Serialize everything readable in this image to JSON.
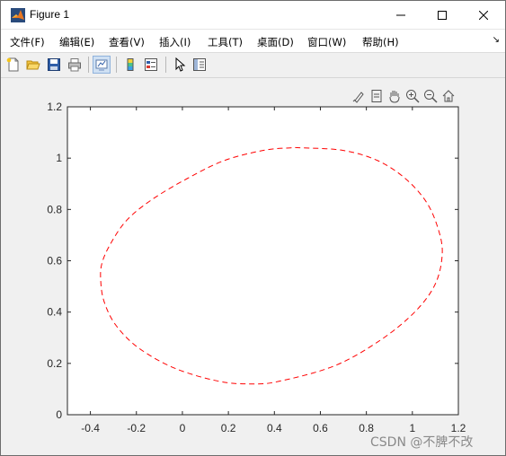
{
  "window": {
    "title": "Figure 1",
    "controls": {
      "minimize": "minimize-icon",
      "maximize": "maximize-icon",
      "close": "close-icon"
    }
  },
  "menu": {
    "items": [
      {
        "label": "文件(F)"
      },
      {
        "label": "编辑(E)"
      },
      {
        "label": "查看(V)"
      },
      {
        "label": "插入(I)"
      },
      {
        "label": "工具(T)"
      },
      {
        "label": "桌面(D)"
      },
      {
        "label": "窗口(W)"
      },
      {
        "label": "帮助(H)"
      }
    ],
    "overflow_icon": "menu-overflow-arrow-icon"
  },
  "toolbar": {
    "buttons": [
      "new-figure-icon",
      "open-file-icon",
      "save-icon",
      "print-icon",
      "link-plot-icon",
      "insert-colorbar-icon",
      "insert-legend-icon",
      "edit-plot-icon",
      "property-inspector-icon"
    ]
  },
  "axes_toolbar": {
    "buttons": [
      "brush-icon",
      "data-tips-icon",
      "pan-icon",
      "zoom-in-icon",
      "zoom-out-icon",
      "home-icon"
    ]
  },
  "chart_data": {
    "type": "line",
    "title": "",
    "xlabel": "",
    "ylabel": "",
    "xlim": [
      -0.5,
      1.2
    ],
    "ylim": [
      0,
      1.2
    ],
    "xticks": [
      -0.4,
      -0.2,
      0,
      0.2,
      0.4,
      0.6,
      0.8,
      1,
      1.2
    ],
    "yticks": [
      0,
      0.2,
      0.4,
      0.6,
      0.8,
      1,
      1.2
    ],
    "xtick_labels": [
      "-0.4",
      "-0.2",
      "0",
      "0.2",
      "0.4",
      "0.6",
      "0.8",
      "1",
      "1.2"
    ],
    "ytick_labels": [
      "0",
      "0.2",
      "0.4",
      "0.6",
      "0.8",
      "1",
      "1.2"
    ],
    "grid": false,
    "series": [
      {
        "color": "#ff0000",
        "line_style": "dashed",
        "shape": "ellipse",
        "x": [
          1.13,
          1.11,
          1.06,
          0.97,
          0.85,
          0.7,
          0.52,
          0.47,
          0.35,
          0.18,
          0.02,
          -0.13,
          -0.24,
          -0.31,
          -0.35,
          -0.355,
          -0.34,
          -0.29,
          -0.19,
          -0.03,
          0.16,
          0.3,
          0.42,
          0.66,
          0.86,
          1.01,
          1.1,
          1.13
        ],
        "y": [
          0.63,
          0.73,
          0.83,
          0.92,
          0.99,
          1.03,
          1.04,
          1.04,
          1.03,
          0.99,
          0.92,
          0.84,
          0.76,
          0.67,
          0.59,
          0.52,
          0.44,
          0.35,
          0.26,
          0.18,
          0.13,
          0.12,
          0.13,
          0.19,
          0.29,
          0.4,
          0.51,
          0.63
        ]
      }
    ]
  },
  "watermark": {
    "text": "CSDN @不脾不改"
  },
  "colors": {
    "window_bg": "#f0f0f0",
    "axes_bg": "#ffffff",
    "line": "#ff0000"
  }
}
